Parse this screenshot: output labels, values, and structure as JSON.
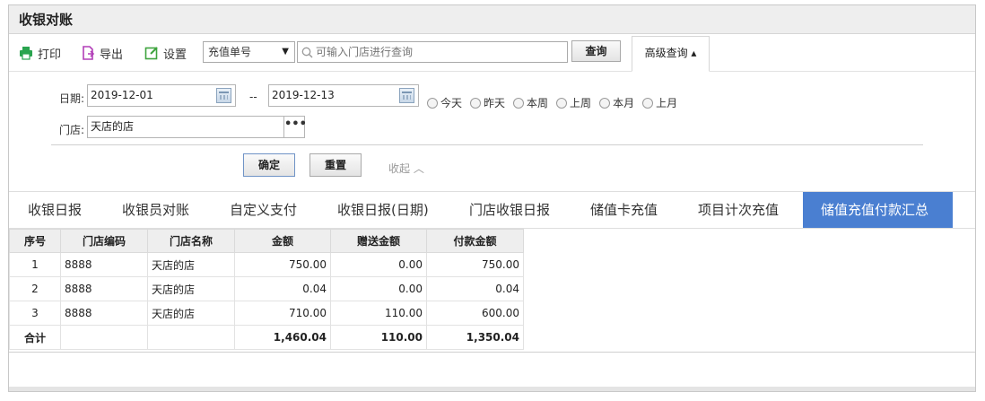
{
  "title": "收银对账",
  "toolbar": {
    "print_label": "打印",
    "export_label": "导出",
    "settings_label": "设置",
    "search_type": "充值单号",
    "search_placeholder": "可输入门店进行查询",
    "query_label": "查询",
    "advanced_label": "高级查询 ▴"
  },
  "filter": {
    "date_label": "日期:",
    "date_from": "2019-12-01",
    "date_sep": "--",
    "date_to": "2019-12-13",
    "quick_ranges": [
      "今天",
      "昨天",
      "本周",
      "上周",
      "本月",
      "上月"
    ],
    "store_label": "门店:",
    "store_value": "天店的店",
    "more_label": "•••",
    "confirm_label": "确定",
    "reset_label": "重置",
    "collapse_label": "收起 ︿"
  },
  "tabs": [
    "收银日报",
    "收银员对账",
    "自定义支付",
    "收银日报(日期)",
    "门店收银日报",
    "储值卡充值",
    "项目计次充值",
    "储值充值付款汇总"
  ],
  "active_tab": 7,
  "table": {
    "headers": [
      "序号",
      "门店编码",
      "门店名称",
      "金额",
      "赠送金额",
      "付款金额"
    ],
    "rows": [
      [
        "1",
        "8888",
        "天店的店",
        "750.00",
        "0.00",
        "750.00"
      ],
      [
        "2",
        "8888",
        "天店的店",
        "0.04",
        "0.00",
        "0.04"
      ],
      [
        "3",
        "8888",
        "天店的店",
        "710.00",
        "110.00",
        "600.00"
      ]
    ],
    "total": [
      "合计",
      "",
      "",
      "1,460.04",
      "110.00",
      "1,350.04"
    ]
  },
  "colors": {
    "accent": "#4a7fd1",
    "print_icon": "#2aa44f",
    "export_icon": "#b23fb8",
    "settings_icon": "#3ea33e"
  }
}
